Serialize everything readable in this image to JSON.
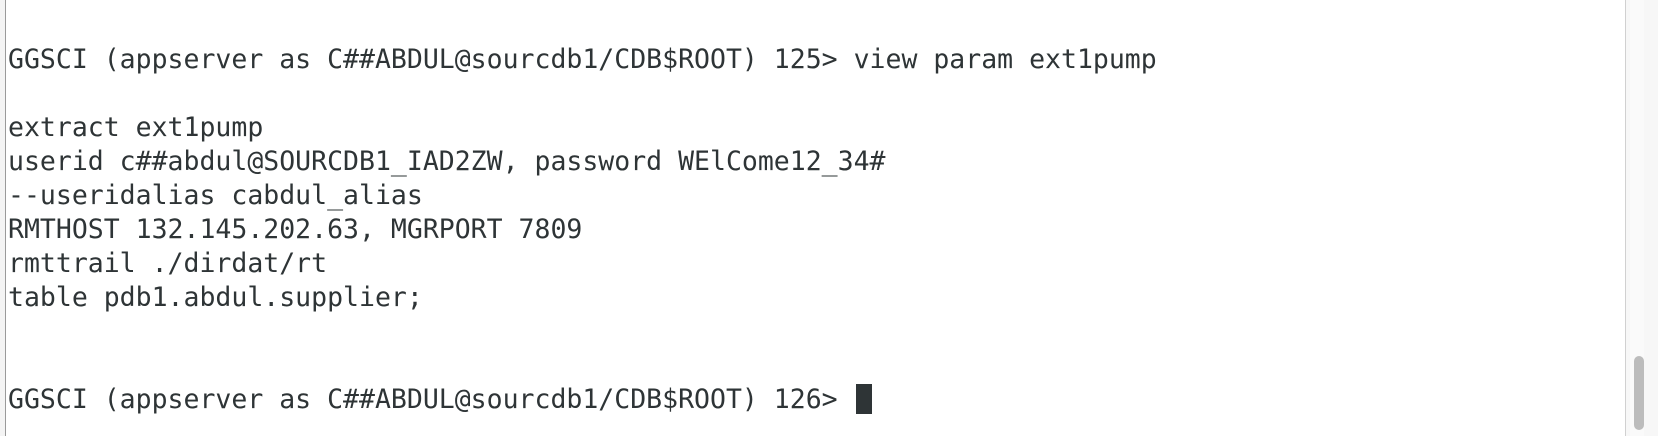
{
  "terminal": {
    "lines": [
      "GGSCI (appserver as C##ABDUL@sourcdb1/CDB$ROOT) 125> view param ext1pump",
      "extract ext1pump",
      "userid c##abdul@SOURCDB1_IAD2ZW, password WElCome12_34#",
      "--useridalias cabdul_alias",
      "RMTHOST 132.145.202.63, MGRPORT 7809",
      "rmttrail ./dirdat/rt",
      "table pdb1.abdul.supplier;",
      "GGSCI (appserver as C##ABDUL@sourcdb1/CDB$ROOT) 126> "
    ]
  },
  "colors": {
    "text": "#2e3436",
    "background": "#ffffff",
    "scroll_thumb": "#bcbcbc"
  },
  "icons": {
    "cursor": "block-cursor-icon"
  }
}
